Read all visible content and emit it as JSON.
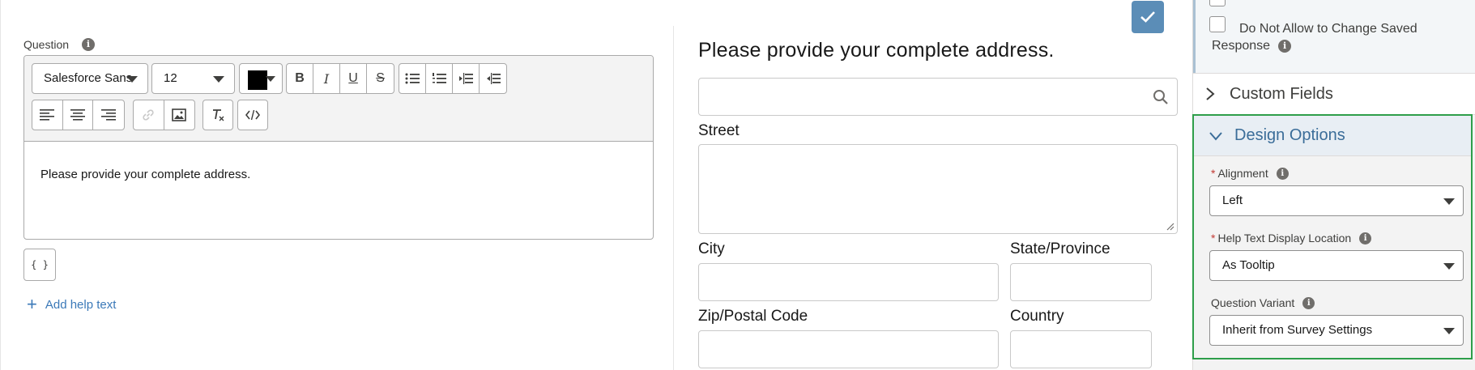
{
  "editor": {
    "question_label": "Question",
    "font_family": "Salesforce Sans",
    "font_size": "12",
    "text_color": "#000000",
    "content": "Please provide your complete address.",
    "merge_field_label": "{ }",
    "add_help_label": "Add help text"
  },
  "preview": {
    "title": "Please provide your complete address.",
    "fields": {
      "street": "Street",
      "city": "City",
      "state": "State/Province",
      "zip": "Zip/Postal Code",
      "country": "Country"
    }
  },
  "settings": {
    "do_not_allow_line1": "Do Not Allow to Change Saved",
    "do_not_allow_line2": "Response",
    "custom_fields": "Custom Fields",
    "design_options": "Design Options",
    "alignment_label": "Alignment",
    "alignment_value": "Left",
    "help_text_label": "Help Text Display Location",
    "help_text_value": "As Tooltip",
    "variant_label": "Question Variant",
    "variant_value": "Inherit from Survey Settings",
    "required_mark": "*"
  },
  "icons": {
    "info": "i",
    "plus": "+"
  },
  "colors": {
    "accent_blue": "#3b79b8",
    "check_button": "#5b8db7",
    "highlight_border": "#2e9e4a"
  }
}
